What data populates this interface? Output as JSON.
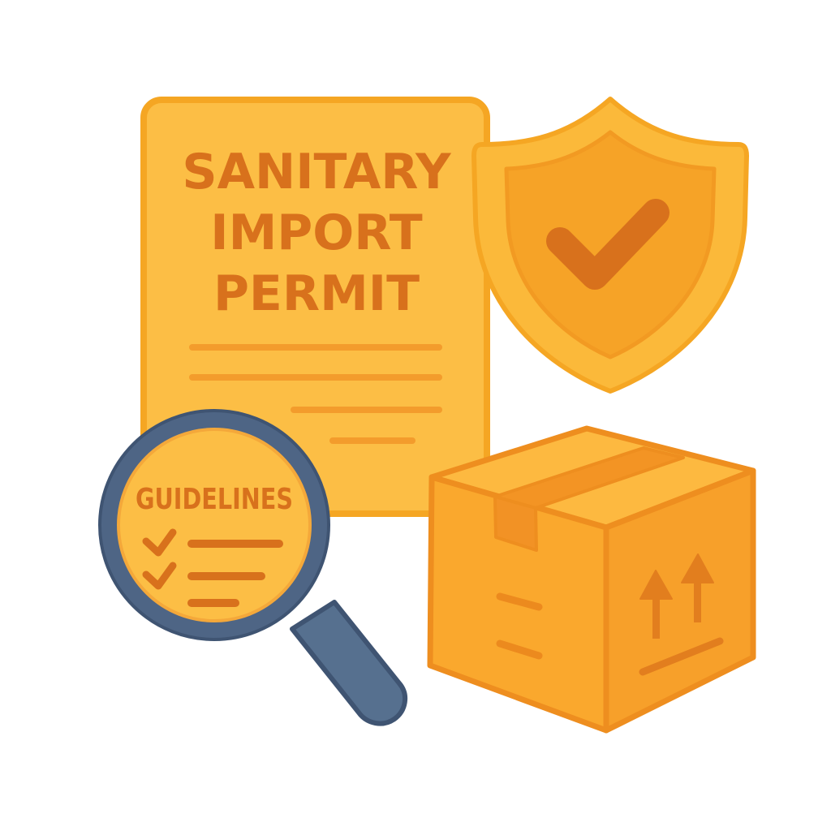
{
  "permit": {
    "title_line1": "SANITARY",
    "title_line2": "IMPORT",
    "title_line3": "PERMIT"
  },
  "magnifier": {
    "label": "GUIDELINES"
  },
  "icons": {
    "document": "document-icon",
    "shield": "shield-check-icon",
    "magnifier": "magnifying-glass-icon",
    "box": "shipping-box-icon",
    "this_side_up": "this-side-up-arrows-icon"
  },
  "colors": {
    "document_fill": "#FCBE45",
    "document_stroke": "#F5A623",
    "text_brown": "#D8711C",
    "line_orange": "#F39C2C",
    "shield_outer": "#FBB93A",
    "shield_inner": "#F6A327",
    "check": "#D8711C",
    "lens_ring": "#4E6585",
    "lens_fill": "#FCBE45",
    "box_front": "#FAA82D",
    "box_side": "#F7A02A",
    "box_top": "#FDB940",
    "box_stroke": "#EE8E1F",
    "tape": "#F39424"
  }
}
